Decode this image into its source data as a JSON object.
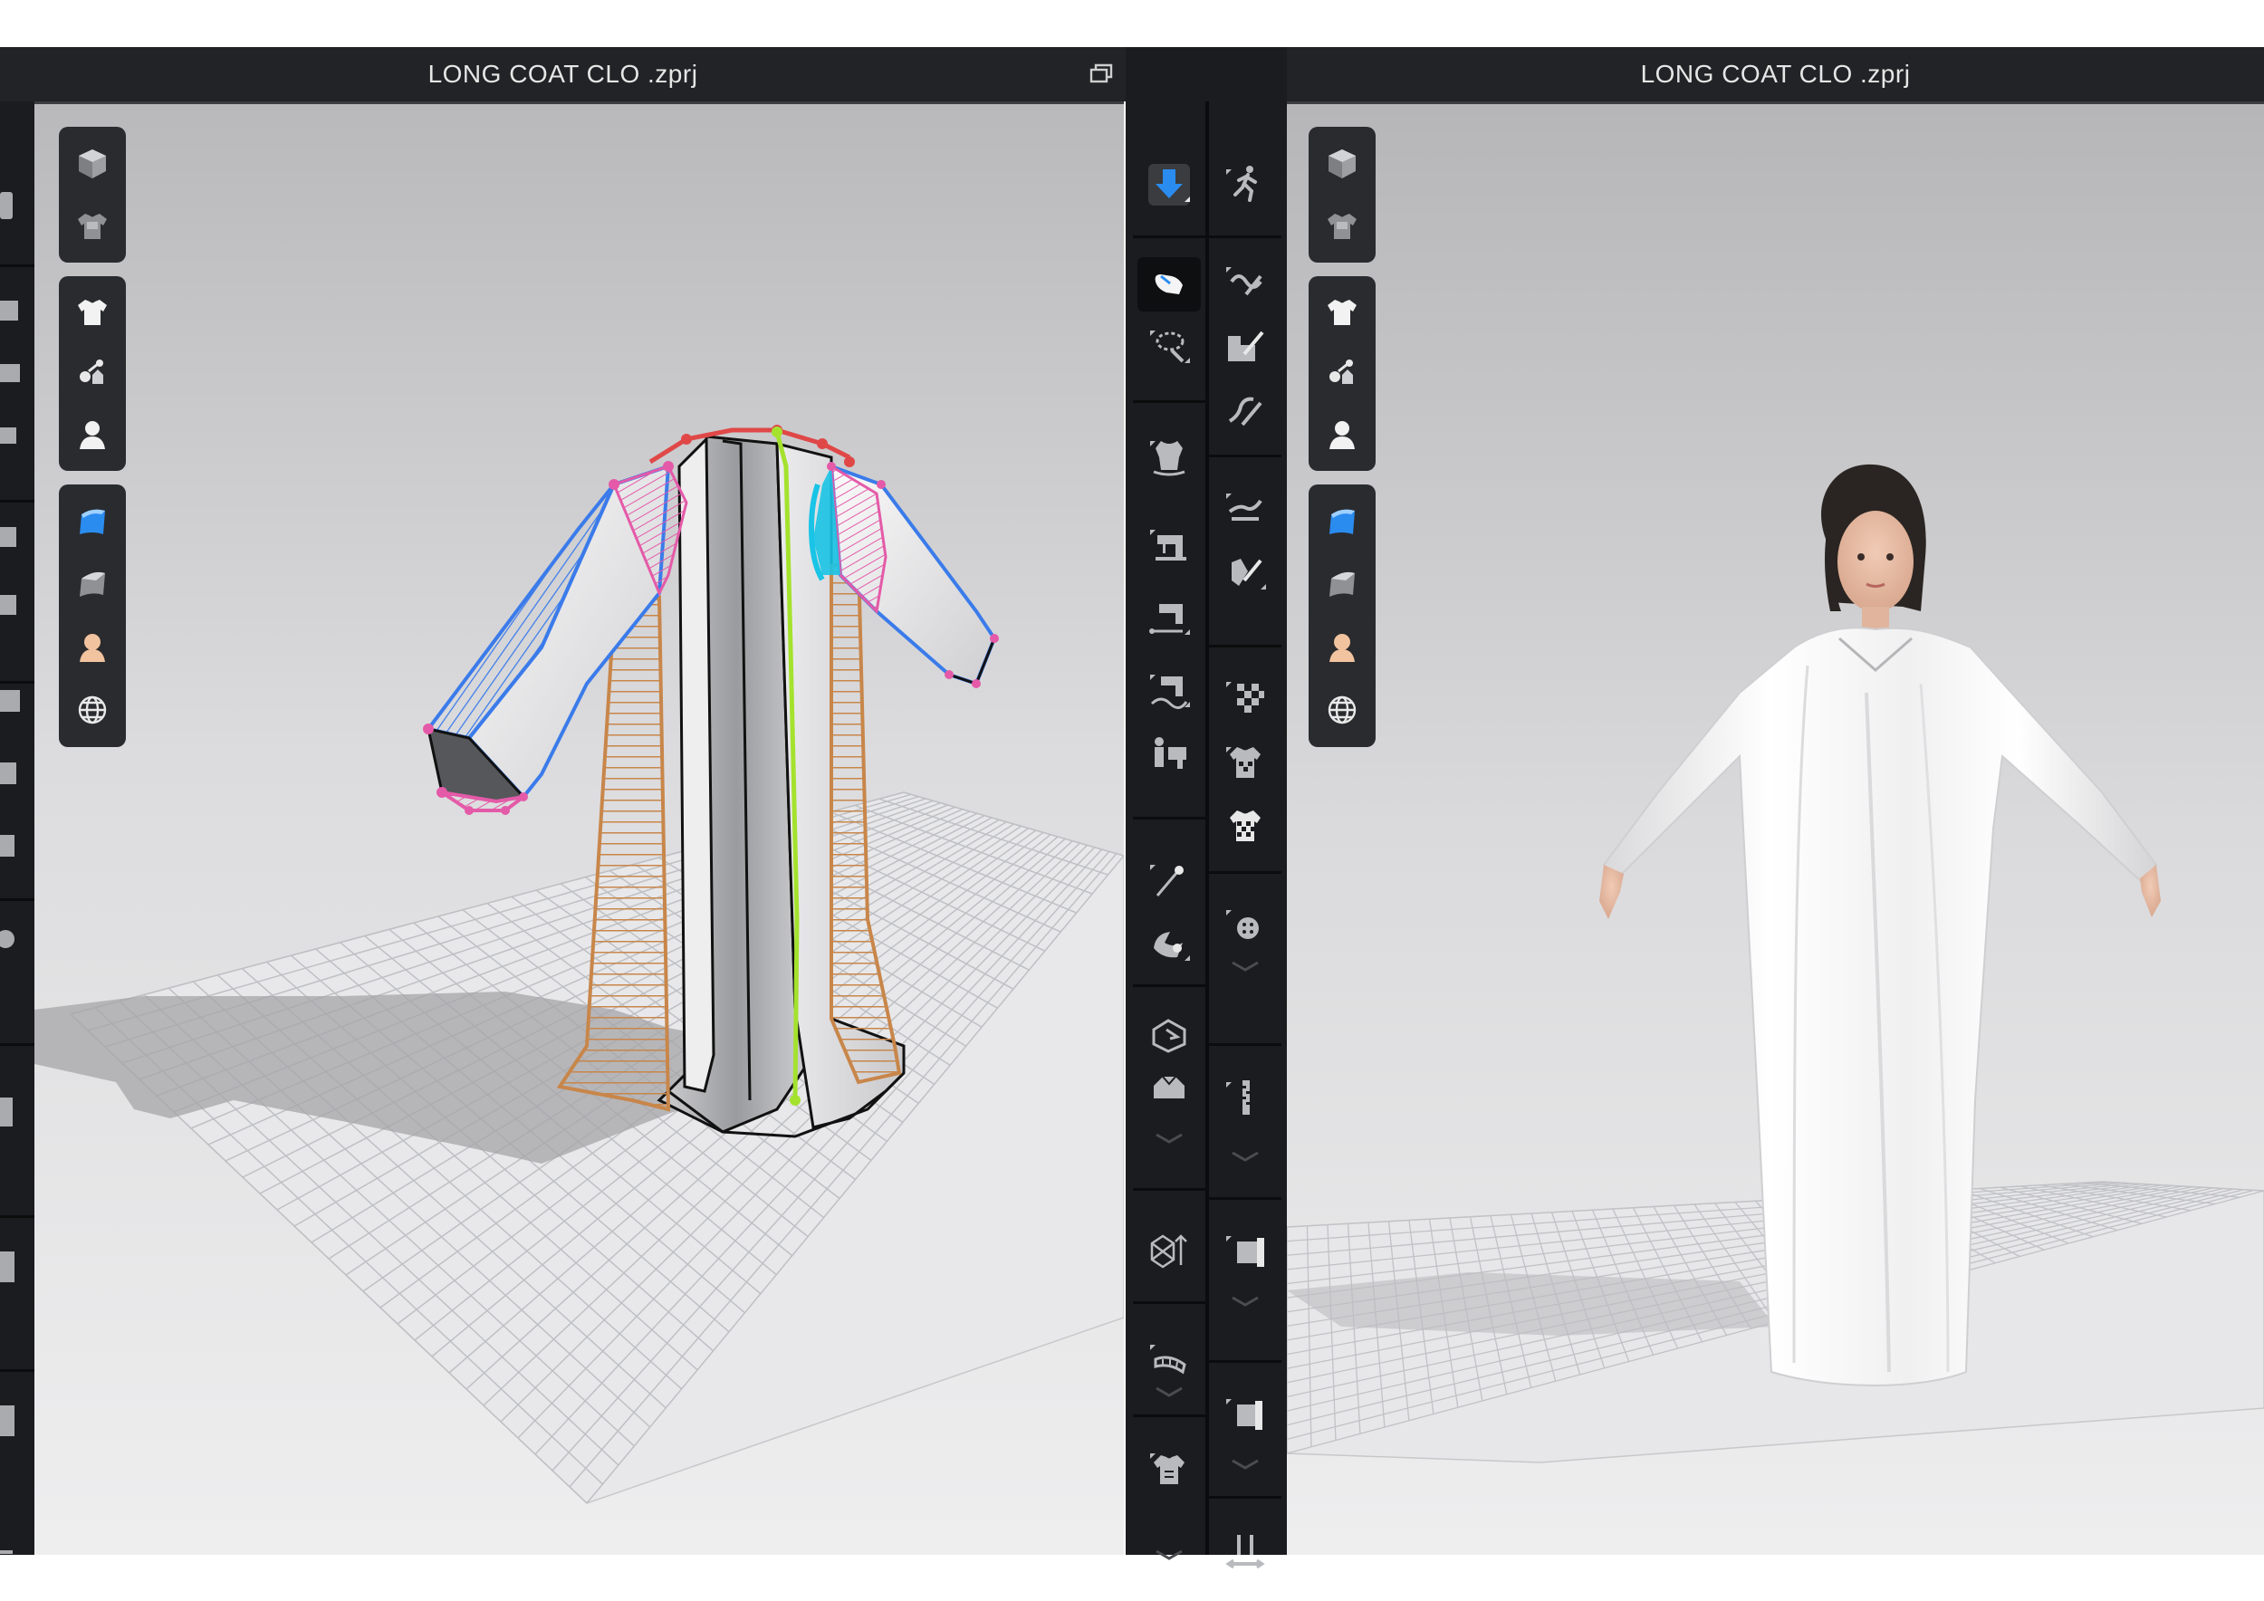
{
  "left_window": {
    "title": "LONG COAT CLO .zprj",
    "restore_icon": "restore-window-icon"
  },
  "right_window": {
    "title": "LONG COAT CLO .zprj"
  },
  "viewport_toolbar": {
    "groups": [
      [
        "display-avatar-cube-icon",
        "display-garment-icon"
      ],
      [
        "show-garment-icon",
        "show-trims-icon",
        "show-avatar-icon"
      ],
      [
        "texture-surface-icon",
        "render-surface-icon",
        "skin-tone-icon",
        "globe-environment-icon"
      ]
    ]
  },
  "middle_toolbar": {
    "left_column": [
      "simulation-arrow-icon",
      "select-move-hand-icon",
      "lasso-select-icon",
      "garment-fit-icon",
      "sewing-machine-icon",
      "sewing-segment-icon",
      "sewing-free-icon",
      "avatar-measure-icon",
      "pin-icon",
      "fold-arrange-icon",
      "export-pattern-icon",
      "garment-flat-icon",
      "pattern-3d-icon",
      "tape-measure-icon",
      "shirt-size-icon"
    ],
    "right_column": [
      "walk-pose-icon",
      "edit-curve-icon",
      "edit-pattern-icon",
      "cut-seam-icon",
      "fold-line-icon",
      "trace-line-icon",
      "checker-board-icon",
      "texture-garment-icon",
      "checker-shirt-icon",
      "button-icon",
      "zipper-icon",
      "puckering-icon",
      "roll-up-icon",
      "elastic-icon"
    ]
  },
  "accent_colors": {
    "chrome": "#222326",
    "toolbar": "#2a2b2e",
    "active_blue": "#2b8cf0",
    "seam_orange": "#c8864a",
    "seam_blue": "#3b7bea",
    "seam_pink": "#e45aa8",
    "seam_cyan": "#19c4e6",
    "seam_green": "#a4e22e",
    "seam_red": "#e04848"
  }
}
